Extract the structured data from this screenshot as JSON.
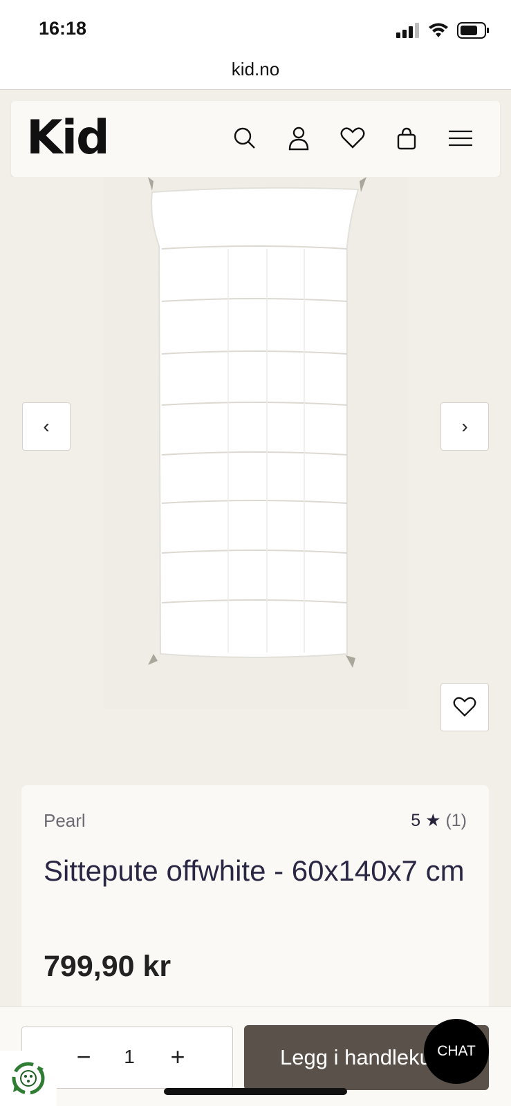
{
  "status_bar": {
    "time": "16:18"
  },
  "browser": {
    "url": "kid.no"
  },
  "header": {
    "logo": "Kid",
    "icons": [
      "search-icon",
      "account-icon",
      "wishlist-icon",
      "cart-icon",
      "menu-icon"
    ]
  },
  "gallery": {
    "prev_symbol": "‹",
    "next_symbol": "›"
  },
  "product": {
    "brand": "Pearl",
    "rating_value": "5 ★",
    "rating_count": "(1)",
    "title": "Sittepute offwhite - 60x140x7 cm",
    "price": "799,90 kr"
  },
  "purchase": {
    "minus": "−",
    "quantity": "1",
    "plus": "+",
    "add_to_cart": "Legg i handlekurv"
  },
  "chat": {
    "label": "CHAT"
  },
  "colors": {
    "background": "#f2efe8",
    "card": "#faf9f5",
    "button_dark": "#5b514b",
    "text_dark": "#26233a",
    "badge_green": "#2e7d32"
  }
}
